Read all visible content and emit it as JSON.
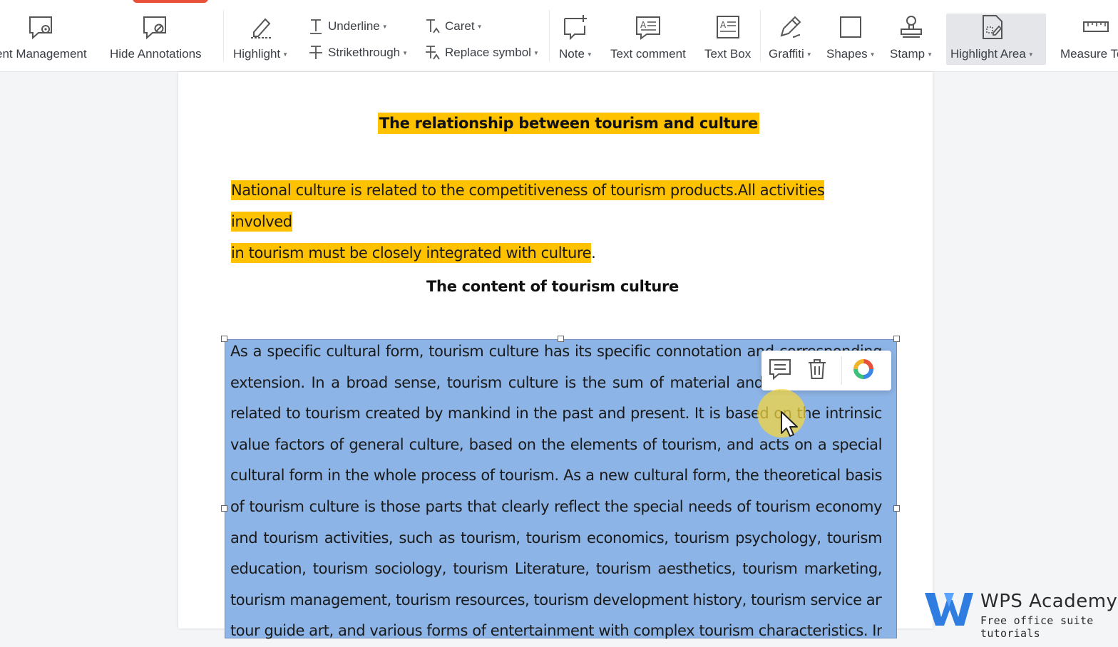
{
  "toolbar": {
    "comment_management": "ent Management",
    "hide_annotations": "Hide Annotations",
    "highlight": "Highlight",
    "underline": "Underline",
    "strikethrough": "Strikethrough",
    "caret": "Caret",
    "replace_symbol": "Replace symbol",
    "note": "Note",
    "text_comment": "Text comment",
    "text_box": "Text Box",
    "graffiti": "Graffiti",
    "shapes": "Shapes",
    "stamp": "Stamp",
    "highlight_area": "Highlight Area",
    "measure": "Measure To"
  },
  "document": {
    "title": "The relationship between tourism and culture",
    "highlighted_line1": "National culture is related to the competitiveness of tourism products.All activities involved",
    "highlighted_line2": "in tourism must be closely integrated with culture",
    "highlighted_tail": ".",
    "section_title": "The content of tourism culture",
    "body_lines": [
      "As a specific cultural form, tourism culture has its specific connotation and corresponding",
      "extension. In a broad sense, tourism culture is the sum of material and spiritual wealth",
      "related to tourism created by mankind in the past and present. It is based on the intrinsic",
      "value factors of general  culture, based on the elements of tourism, and acts on a  special",
      "cultural form in the whole process of tourism. As a new cultural form, the theoretical basis",
      "of tourism culture is those parts that clearly reflect the special needs of tourism economy",
      "and tourism activities, such as tourism, tourism economics, tourism psychology, tourism",
      "education, tourism sociology, tourism Literature, tourism aesthetics, tourism marketing,",
      "tourism management, tourism resources, tourism development history, tourism service art,",
      "tour guide art, and various forms of entertainment with complex tourism characteristics. In"
    ]
  },
  "watermark": {
    "title": "WPS Academy",
    "subtitle": "Free office suite tutorials"
  },
  "colors": {
    "highlight_yellow": "#ffc200",
    "selection_blue": "#8db4e6",
    "brand_blue": "#2f7de1"
  }
}
